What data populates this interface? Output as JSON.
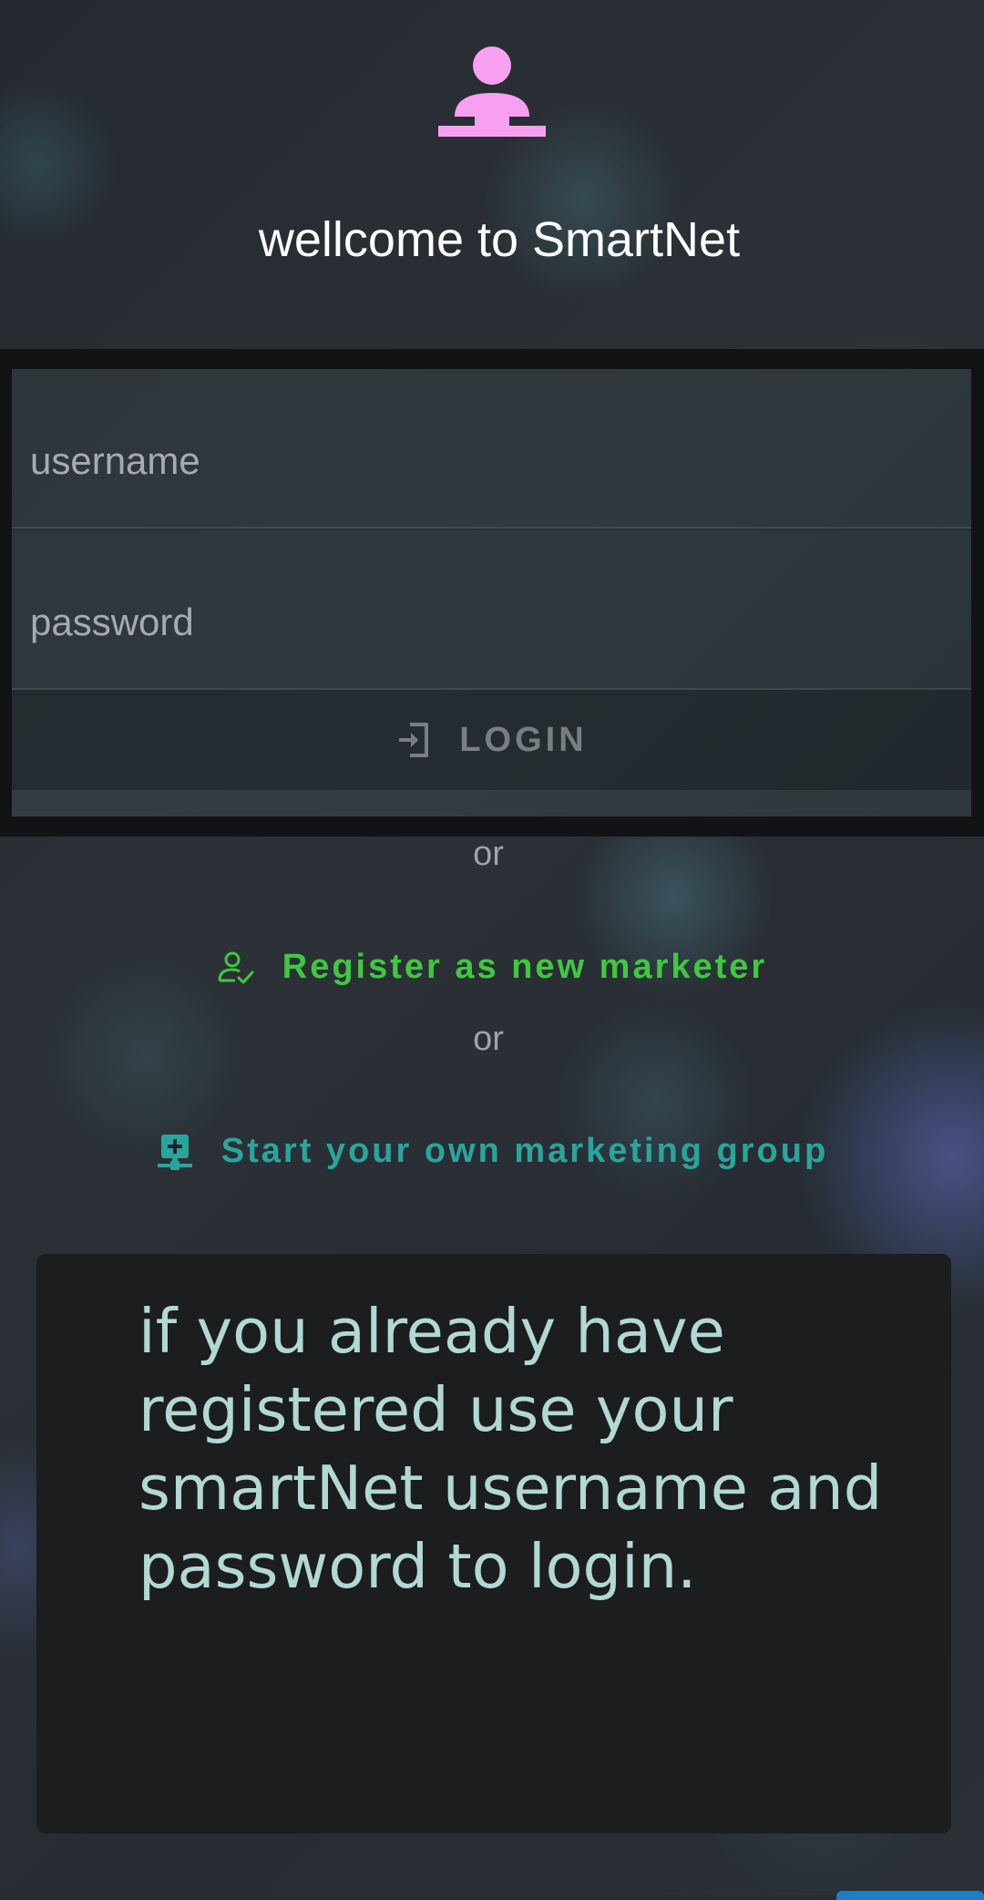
{
  "app": {
    "title": "wellcome to SmartNet"
  },
  "header": {
    "icon": "network-person-icon",
    "icon_color": "#f8a0f0"
  },
  "login": {
    "username_placeholder": "username",
    "password_placeholder": "password",
    "button_label": "LOGIN",
    "button_icon": "login-icon"
  },
  "separators": {
    "first": "or",
    "second": "or"
  },
  "links": {
    "register_label": "Register as new marketer",
    "register_icon": "user-check-icon",
    "register_color": "#3fc93f",
    "group_label": "Start your own marketing group",
    "group_icon": "network-add-icon",
    "group_color": "#2aa59d"
  },
  "info": {
    "message": "if you already have registered use your smartNet username and password to login."
  }
}
